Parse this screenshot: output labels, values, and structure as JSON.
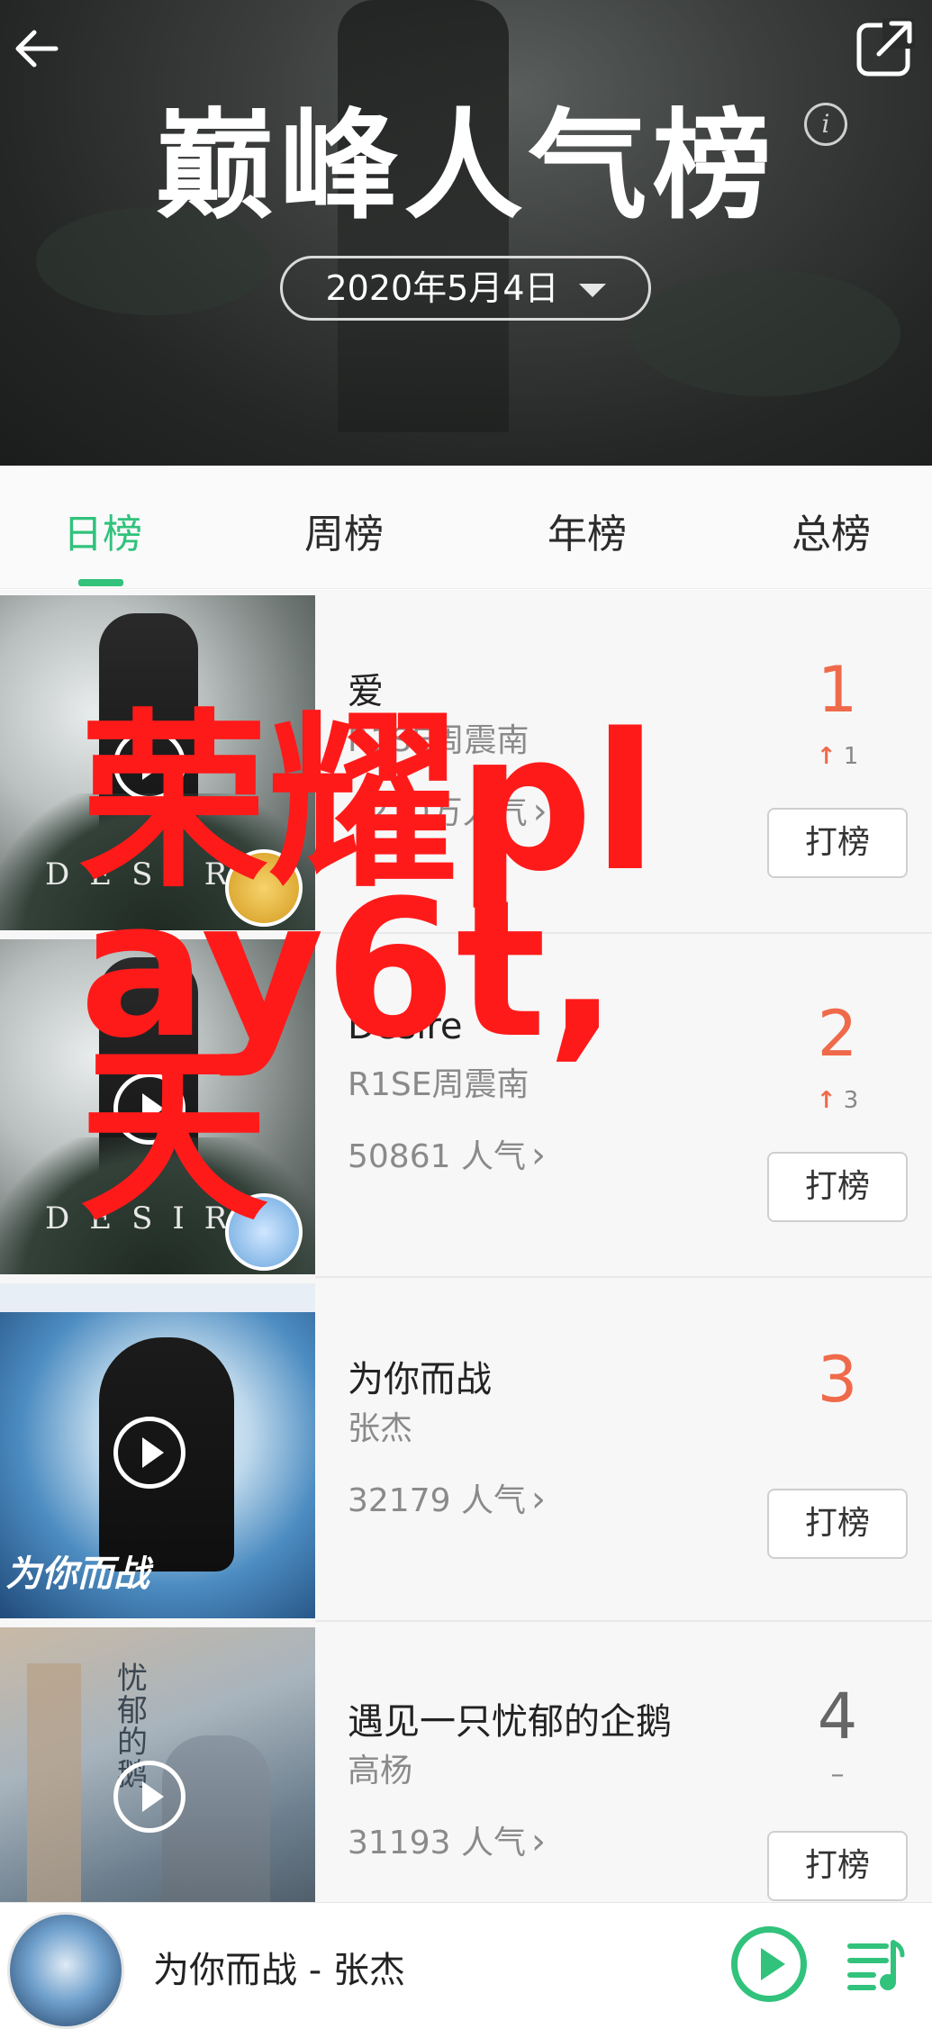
{
  "header": {
    "title": "巅峰人气榜",
    "date": "2020年5月4日",
    "icons": {
      "back": "back-arrow-icon",
      "share": "share-icon",
      "info": "info-icon",
      "dropdown": "caret-down-icon"
    }
  },
  "tabs": [
    {
      "label": "日榜",
      "active": true
    },
    {
      "label": "周榜",
      "active": false
    },
    {
      "label": "年榜",
      "active": false
    },
    {
      "label": "总榜",
      "active": false
    }
  ],
  "songs": [
    {
      "title": "爱",
      "artist": "R1SE周震南",
      "popularity": "1220万人气",
      "rank": "1",
      "trend": "1",
      "trend_dir": "up",
      "vote_label": "打榜",
      "cover_text": "DESIRE"
    },
    {
      "title": "Desire",
      "artist": "R1SE周震南",
      "popularity": "50861 人气",
      "rank": "2",
      "trend": "3",
      "trend_dir": "up",
      "vote_label": "打榜",
      "cover_text": "DESIRE"
    },
    {
      "title": "为你而战",
      "artist": "张杰",
      "popularity": "32179 人气",
      "rank": "3",
      "trend": "",
      "trend_dir": "none",
      "vote_label": "打榜",
      "cover_text": "为你而战"
    },
    {
      "title": "遇见一只忧郁的企鹅",
      "artist": "高杨",
      "popularity": "31193 人气",
      "rank": "4",
      "trend": "–",
      "trend_dir": "same",
      "vote_label": "打榜",
      "cover_text": "忧郁的鹅"
    }
  ],
  "player": {
    "now_playing": "为你而战 - 张杰"
  },
  "watermark": "荣耀play6t,天",
  "colors": {
    "accent": "#31c27c",
    "rank": "#ef6a4a",
    "watermark": "#ff1a1a"
  }
}
